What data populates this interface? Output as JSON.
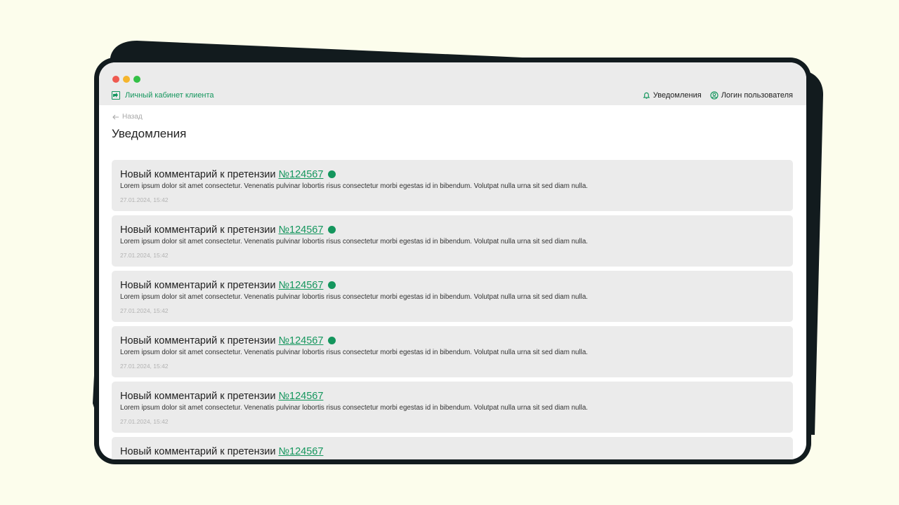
{
  "header": {
    "brand_label": "Личный кабинет клиента",
    "notifications_label": "Уведомления",
    "user_label": "Логин пользователя"
  },
  "page": {
    "back_label": "Назад",
    "title": "Уведомления"
  },
  "notifications": [
    {
      "title": "Новый комментарий к претензии",
      "ticket": "№124567",
      "unread": true,
      "text": "Lorem ipsum dolor sit amet consectetur. Venenatis pulvinar lobortis risus consectetur morbi egestas id in bibendum. Volutpat nulla urna sit sed diam nulla.",
      "date": "27.01.2024, 15:42"
    },
    {
      "title": "Новый комментарий к претензии",
      "ticket": "№124567",
      "unread": true,
      "text": "Lorem ipsum dolor sit amet consectetur. Venenatis pulvinar lobortis risus consectetur morbi egestas id in bibendum. Volutpat nulla urna sit sed diam nulla.",
      "date": "27.01.2024, 15:42"
    },
    {
      "title": "Новый комментарий к претензии",
      "ticket": "№124567",
      "unread": true,
      "text": "Lorem ipsum dolor sit amet consectetur. Venenatis pulvinar lobortis risus consectetur morbi egestas id in bibendum. Volutpat nulla urna sit sed diam nulla.",
      "date": "27.01.2024, 15:42"
    },
    {
      "title": "Новый комментарий к претензии",
      "ticket": "№124567",
      "unread": true,
      "text": "Lorem ipsum dolor sit amet consectetur. Venenatis pulvinar lobortis risus consectetur morbi egestas id in bibendum. Volutpat nulla urna sit sed diam nulla.",
      "date": "27.01.2024, 15:42"
    },
    {
      "title": "Новый комментарий к претензии",
      "ticket": "№124567",
      "unread": false,
      "text": "Lorem ipsum dolor sit amet consectetur. Venenatis pulvinar lobortis risus consectetur morbi egestas id in bibendum. Volutpat nulla urna sit sed diam nulla.",
      "date": "27.01.2024, 15:42"
    },
    {
      "title": "Новый комментарий к претензии",
      "ticket": "№124567",
      "unread": false,
      "text": "",
      "date": ""
    }
  ],
  "colors": {
    "accent": "#14965d",
    "background": "#FCFDEC",
    "frame": "#121b1e",
    "card": "#ebebeb"
  },
  "icons": {
    "back": "arrow-left-icon",
    "bell": "bell-icon",
    "user": "user-circle-icon",
    "brand": "logo-icon"
  }
}
